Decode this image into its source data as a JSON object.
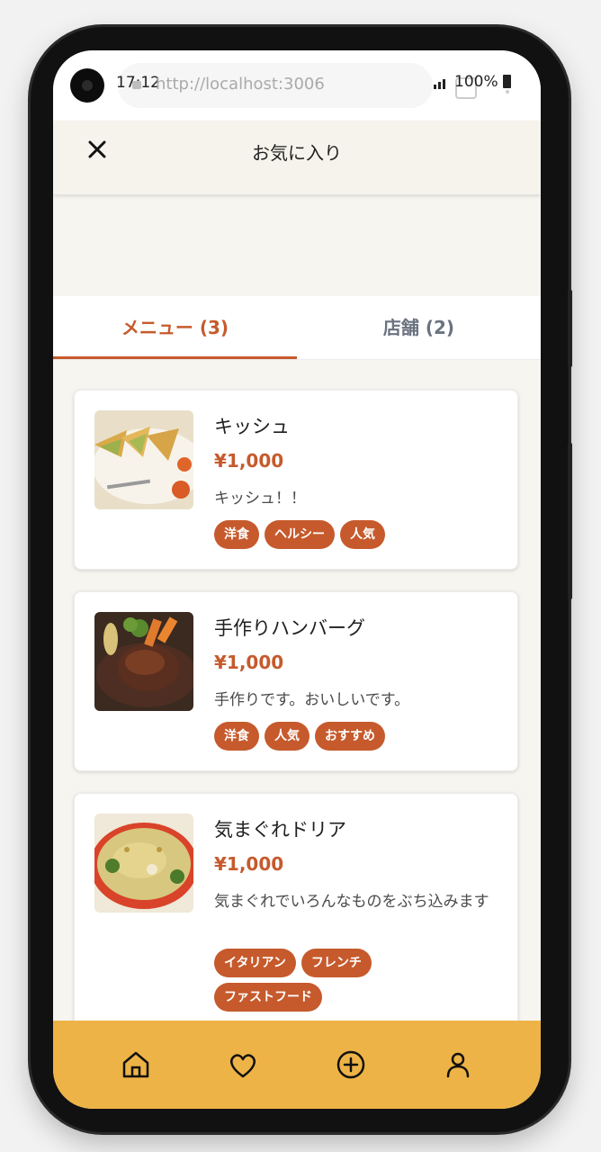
{
  "status": {
    "time": "17:12",
    "url": "http://localhost:3006",
    "battery": "100%"
  },
  "header": {
    "title": "お気に入り"
  },
  "tabs": [
    {
      "label": "メニュー (3)",
      "active": true
    },
    {
      "label": "店舗 (2)",
      "active": false
    }
  ],
  "menu_items": [
    {
      "name": "キッシュ",
      "price": "¥1,000",
      "description": "キッシュ！！",
      "tags": [
        "洋食",
        "ヘルシー",
        "人気"
      ]
    },
    {
      "name": "手作りハンバーグ",
      "price": "¥1,000",
      "description": "手作りです。おいしいです。",
      "tags": [
        "洋食",
        "人気",
        "おすすめ"
      ]
    },
    {
      "name": "気まぐれドリア",
      "price": "¥1,000",
      "description": "気まぐれでいろんなものをぶち込みます",
      "tags": [
        "イタリアン",
        "フレンチ",
        "ファストフード"
      ]
    }
  ],
  "bottom_nav": [
    {
      "icon": "home-icon"
    },
    {
      "icon": "heart-icon"
    },
    {
      "icon": "plus-circle-icon"
    },
    {
      "icon": "user-icon"
    }
  ],
  "colors": {
    "accent": "#c65a2c",
    "nav_background": "#edb346",
    "header_background": "#f6f3ec"
  }
}
